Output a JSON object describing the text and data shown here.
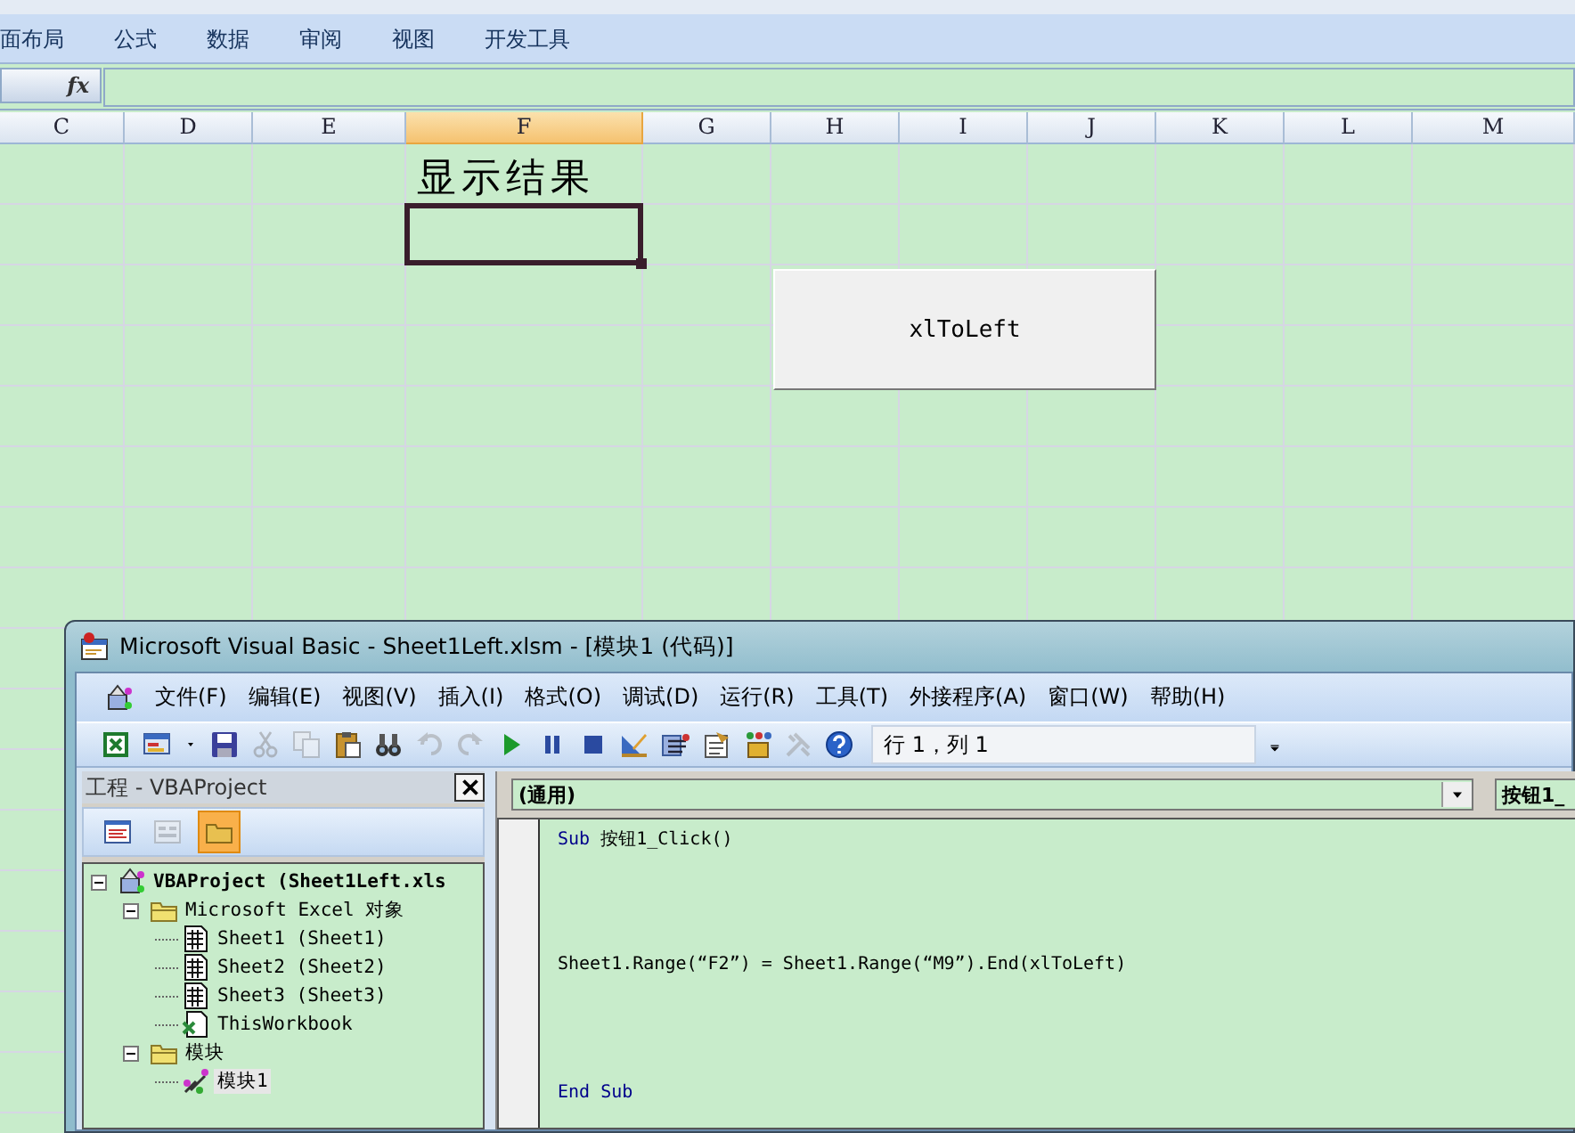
{
  "ribbon": {
    "tabs": [
      {
        "label": "面布局"
      },
      {
        "label": "公式"
      },
      {
        "label": "数据"
      },
      {
        "label": "审阅"
      },
      {
        "label": "视图"
      },
      {
        "label": "开发工具"
      }
    ]
  },
  "formula_bar": {
    "function_label": "fx"
  },
  "sheet": {
    "columns": [
      {
        "label": "C",
        "selected": false
      },
      {
        "label": "D",
        "selected": false
      },
      {
        "label": "E",
        "selected": false
      },
      {
        "label": "F",
        "selected": true
      },
      {
        "label": "G",
        "selected": false
      },
      {
        "label": "H",
        "selected": false
      },
      {
        "label": "I",
        "selected": false
      },
      {
        "label": "J",
        "selected": false
      },
      {
        "label": "K",
        "selected": false
      },
      {
        "label": "L",
        "selected": false
      },
      {
        "label": "M",
        "selected": false
      }
    ],
    "heading": "显示结果",
    "button": "xlToLeft"
  },
  "vbe": {
    "title": "Microsoft Visual Basic - Sheet1Left.xlsm - [模块1 (代码)]",
    "menu": [
      "文件(F)",
      "编辑(E)",
      "视图(V)",
      "插入(I)",
      "格式(O)",
      "调试(D)",
      "运行(R)",
      "工具(T)",
      "外接程序(A)",
      "窗口(W)",
      "帮助(H)"
    ],
    "toolbar": [
      {
        "kind": "excel",
        "disabled": false
      },
      {
        "kind": "userform",
        "disabled": false
      },
      {
        "kind": "save",
        "disabled": false
      },
      {
        "kind": "cut",
        "disabled": true
      },
      {
        "kind": "copy",
        "disabled": true
      },
      {
        "kind": "paste",
        "disabled": false
      },
      {
        "kind": "find",
        "disabled": false
      },
      {
        "kind": "undo",
        "disabled": true
      },
      {
        "kind": "redo",
        "disabled": true
      },
      {
        "kind": "run",
        "disabled": false
      },
      {
        "kind": "pause",
        "disabled": false
      },
      {
        "kind": "stop",
        "disabled": false
      },
      {
        "kind": "design",
        "disabled": false
      },
      {
        "kind": "explorer",
        "disabled": false
      },
      {
        "kind": "properties",
        "disabled": false
      },
      {
        "kind": "browser",
        "disabled": false
      },
      {
        "kind": "toolbox",
        "disabled": true
      },
      {
        "kind": "help",
        "disabled": false
      }
    ],
    "position": "行 1，列 1",
    "project": {
      "title": "工程 - VBAProject",
      "toolbar": [
        {
          "kind": "code",
          "disabled": false,
          "pressed": false
        },
        {
          "kind": "object",
          "disabled": true,
          "pressed": false
        },
        {
          "kind": "folders",
          "disabled": false,
          "pressed": true
        }
      ],
      "tree": [
        {
          "label": "VBAProject (Sheet1Left.xls",
          "kind": "project",
          "expanded": true,
          "selected": false,
          "children": [
            {
              "label": "Microsoft Excel 对象",
              "kind": "folder",
              "expanded": true,
              "selected": false,
              "children": [
                {
                  "label": "Sheet1 (Sheet1)",
                  "kind": "sheet",
                  "selected": false
                },
                {
                  "label": "Sheet2 (Sheet2)",
                  "kind": "sheet",
                  "selected": false
                },
                {
                  "label": "Sheet3 (Sheet3)",
                  "kind": "sheet",
                  "selected": false
                },
                {
                  "label": "ThisWorkbook",
                  "kind": "workbook",
                  "selected": false
                }
              ]
            },
            {
              "label": "模块",
              "kind": "folder",
              "expanded": true,
              "selected": false,
              "children": [
                {
                  "label": "模块1",
                  "kind": "module",
                  "selected": true
                }
              ]
            }
          ]
        }
      ]
    },
    "code": {
      "object_dropdown": "(通用)",
      "procedure_dropdown": "按钮1_",
      "lines": [
        {
          "segments": [
            {
              "text": "Sub",
              "kind": "keyword"
            },
            {
              "text": " 按钮1_Click()",
              "kind": "plain"
            }
          ]
        },
        {
          "segments": [
            {
              "text": "Sheet1.Range(“F2”) = Sheet1.Range(“M9”).End(xlToLeft)",
              "kind": "plain"
            }
          ]
        },
        {
          "segments": [
            {
              "text": "End Sub",
              "kind": "keyword"
            }
          ]
        }
      ]
    }
  }
}
